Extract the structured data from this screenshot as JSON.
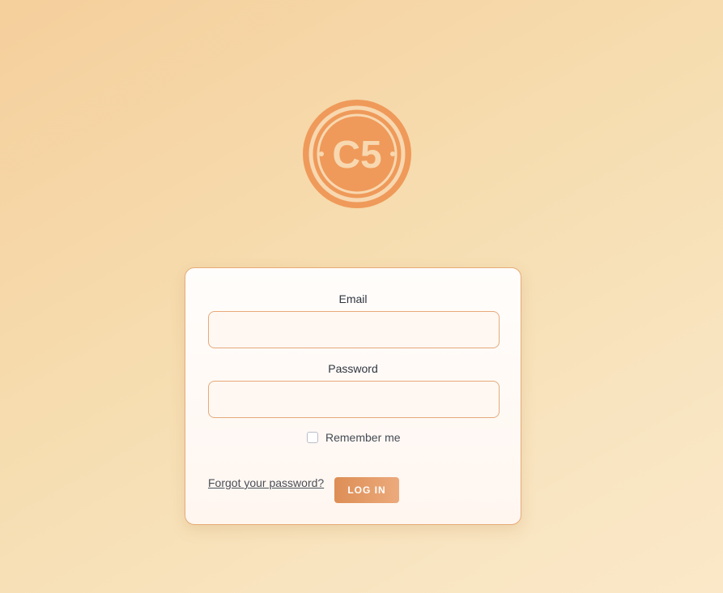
{
  "logo": {
    "text": "C5",
    "color": "#ef9a5a",
    "inner_color": "#f8d8b0"
  },
  "form": {
    "email_label": "Email",
    "email_value": "",
    "password_label": "Password",
    "password_value": "",
    "remember_label": "Remember me",
    "remember_checked": false,
    "forgot_label": "Forgot your password?",
    "login_label": "LOG IN"
  },
  "colors": {
    "accent": "#e8ab76",
    "button": "#dd8e55"
  }
}
